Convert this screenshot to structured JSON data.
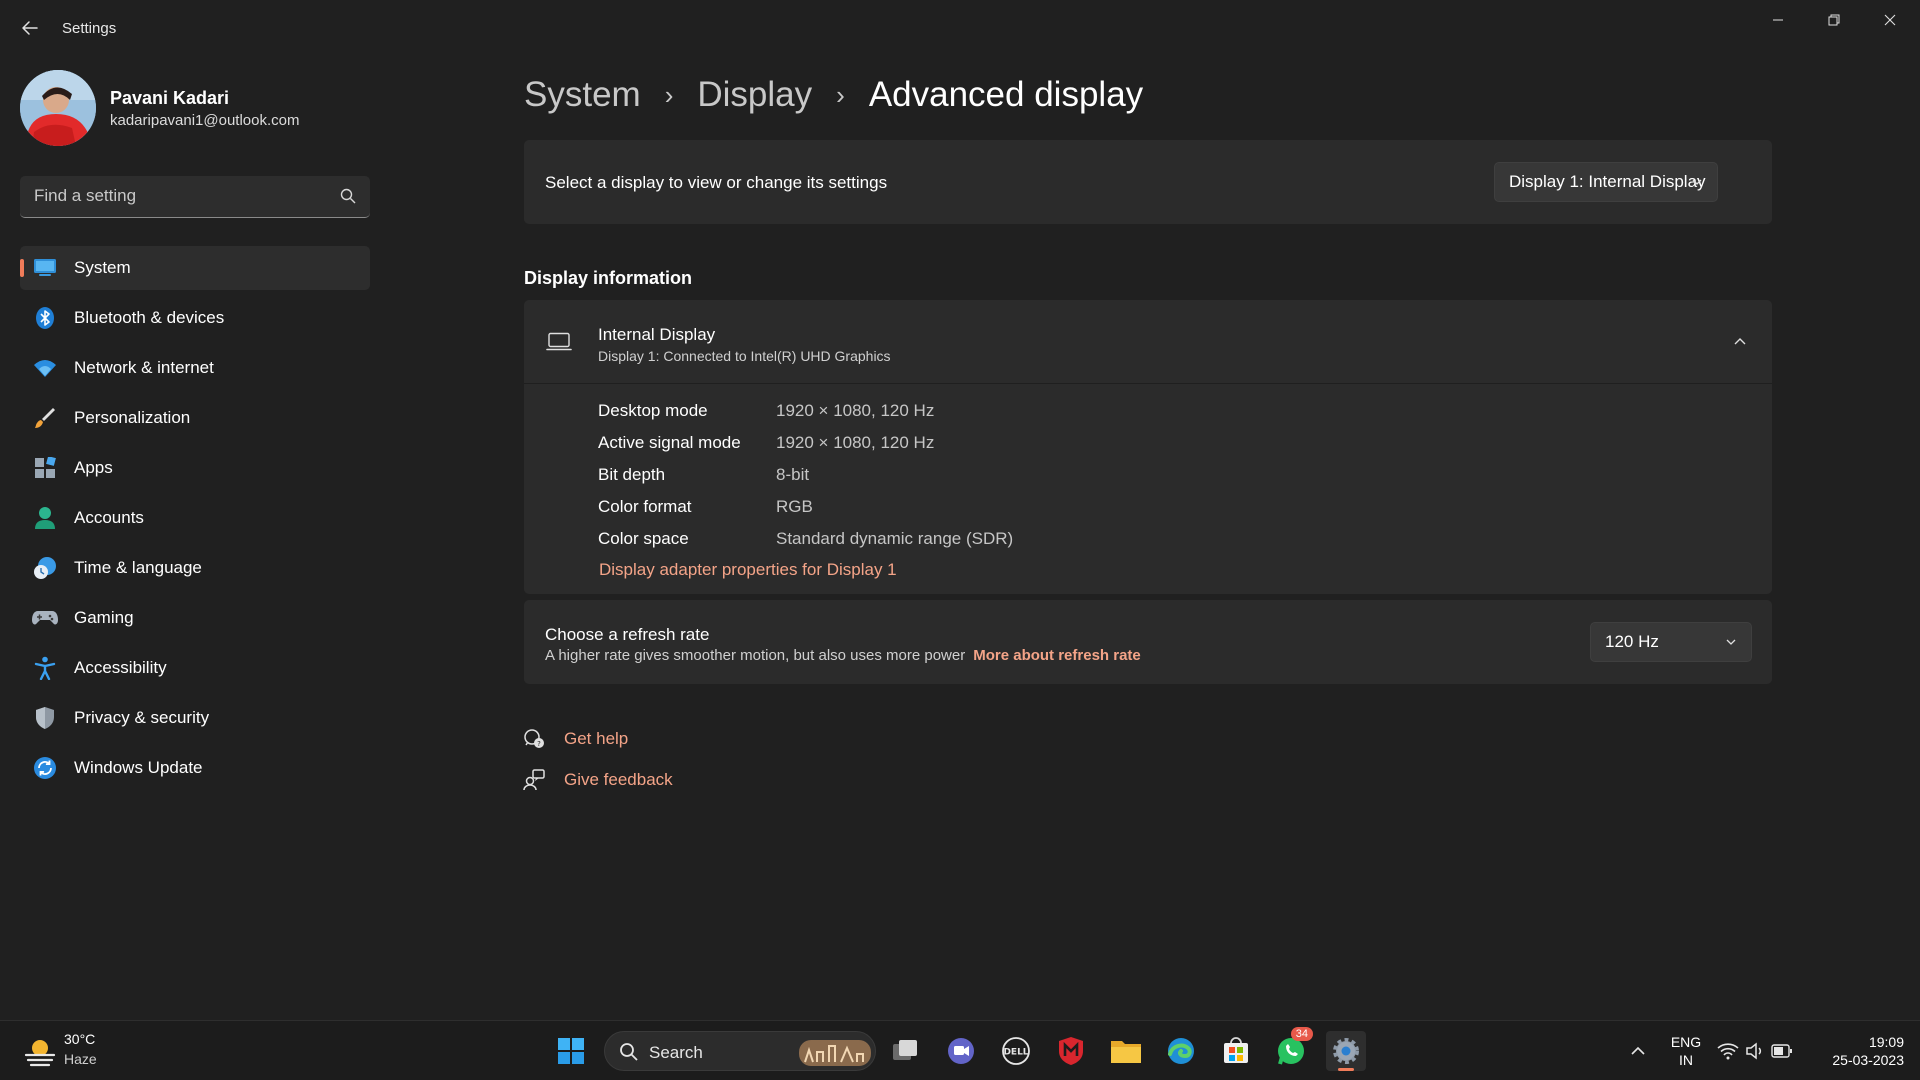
{
  "window": {
    "title": "Settings"
  },
  "profile": {
    "name": "Pavani Kadari",
    "email": "kadaripavani1@outlook.com"
  },
  "search": {
    "placeholder": "Find a setting"
  },
  "nav": {
    "items": [
      {
        "label": "System",
        "icon": "monitor-icon",
        "active": true
      },
      {
        "label": "Bluetooth & devices",
        "icon": "bluetooth-icon"
      },
      {
        "label": "Network & internet",
        "icon": "wifi-icon"
      },
      {
        "label": "Personalization",
        "icon": "paintbrush-icon"
      },
      {
        "label": "Apps",
        "icon": "apps-icon"
      },
      {
        "label": "Accounts",
        "icon": "person-icon"
      },
      {
        "label": "Time & language",
        "icon": "clock-globe-icon"
      },
      {
        "label": "Gaming",
        "icon": "gamepad-icon"
      },
      {
        "label": "Accessibility",
        "icon": "accessibility-icon"
      },
      {
        "label": "Privacy & security",
        "icon": "shield-icon"
      },
      {
        "label": "Windows Update",
        "icon": "update-icon"
      }
    ]
  },
  "breadcrumb": {
    "items": [
      "System",
      "Display",
      "Advanced display"
    ],
    "separator": "›"
  },
  "select_display": {
    "label": "Select a display to view or change its settings",
    "value": "Display 1: Internal Display"
  },
  "display_info": {
    "section_title": "Display information",
    "title": "Internal Display",
    "subtitle": "Display 1: Connected to Intel(R) UHD Graphics",
    "properties": [
      {
        "key": "Desktop mode",
        "value": "1920 × 1080, 120 Hz"
      },
      {
        "key": "Active signal mode",
        "value": "1920 × 1080, 120 Hz"
      },
      {
        "key": "Bit depth",
        "value": "8-bit"
      },
      {
        "key": "Color format",
        "value": "RGB"
      },
      {
        "key": "Color space",
        "value": "Standard dynamic range (SDR)"
      }
    ],
    "adapter_link": "Display adapter properties for Display 1"
  },
  "refresh": {
    "title": "Choose a refresh rate",
    "subtitle": "A higher rate gives smoother motion, but also uses more power",
    "more_link": "More about refresh rate",
    "value": "120 Hz"
  },
  "help": {
    "get_help": "Get help",
    "give_feedback": "Give feedback"
  },
  "taskbar": {
    "weather_temp": "30°C",
    "weather_condition": "Haze",
    "search_label": "Search",
    "whatsapp_badge": "34",
    "lang_line1": "ENG",
    "lang_line2": "IN",
    "time": "19:09",
    "date": "25-03-2023"
  },
  "colors": {
    "accent": "#f07c5a",
    "link": "#f4a488",
    "background": "#202020",
    "card": "#2b2b2b"
  }
}
